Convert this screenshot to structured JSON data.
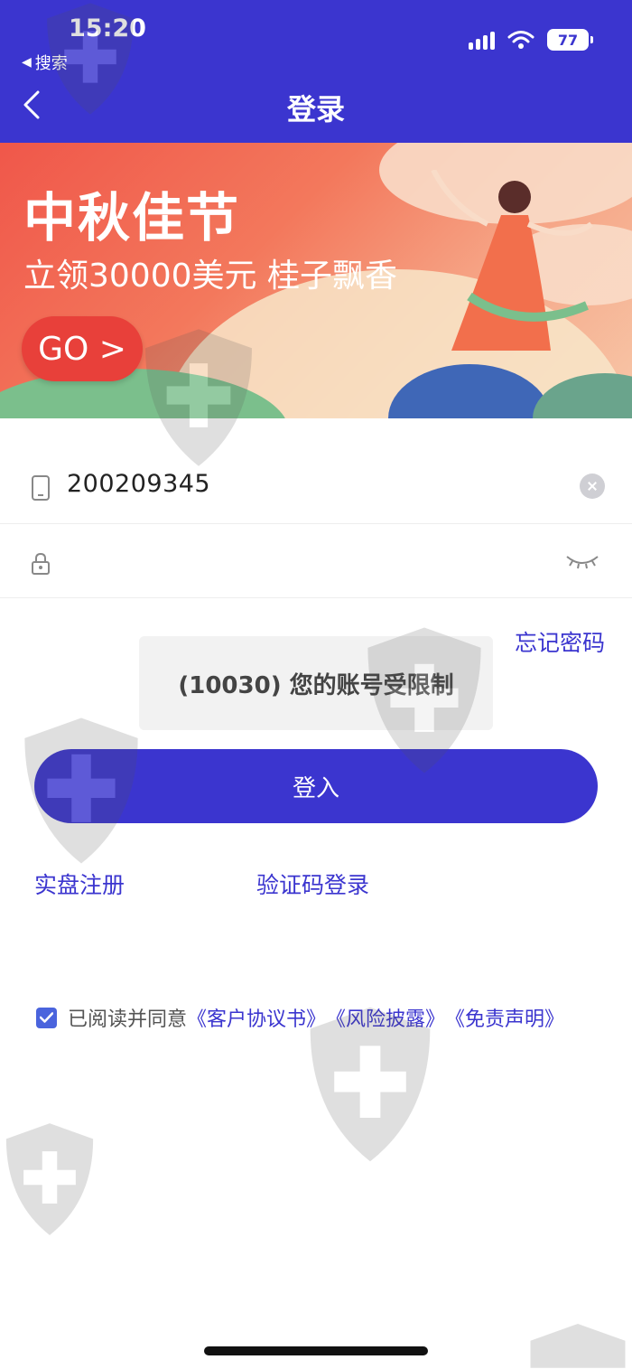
{
  "status_bar": {
    "time": "15:20",
    "back_app_label": "搜索",
    "battery": "77",
    "icons": [
      "signal-icon",
      "wifi-icon",
      "battery-icon"
    ]
  },
  "nav": {
    "title": "登录",
    "back_icon": "chevron-left-icon"
  },
  "banner": {
    "title": "中秋佳节",
    "subtitle": "立领30000美元 桂子飘香",
    "button": "GO >"
  },
  "form": {
    "phone_value": "200209345",
    "password_value": "",
    "forgot_password": "忘记密码",
    "error_message": "(10030) 您的账号受限制",
    "login_button": "登入"
  },
  "links": {
    "register": "实盘注册",
    "code_login": "验证码登录"
  },
  "agreement": {
    "checked": true,
    "prefix": "已阅读并同意",
    "docs": [
      "《客户协议书》",
      "《风险披露》",
      "《免责声明》"
    ]
  },
  "colors": {
    "primary": "#3b35cf",
    "banner_red": "#e8403a"
  }
}
